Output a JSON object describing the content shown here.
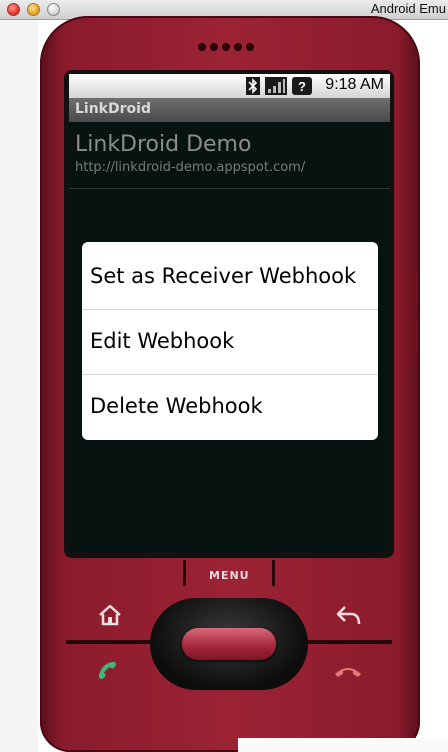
{
  "window": {
    "title": "Android Emu"
  },
  "status_bar": {
    "time": "9:18 AM",
    "icons": [
      "bluetooth-icon",
      "signal-icon",
      "alert-icon"
    ]
  },
  "app": {
    "title": "LinkDroid"
  },
  "list": {
    "item_title": "LinkDroid Demo",
    "item_url": "http://linkdroid-demo.appspot.com/"
  },
  "context_menu": {
    "items": [
      {
        "label": "Set as Receiver Webhook"
      },
      {
        "label": "Edit Webhook"
      },
      {
        "label": "Delete Webhook"
      }
    ]
  },
  "device": {
    "menu_label": "MENU",
    "buttons": [
      "home-icon",
      "back-icon",
      "call-icon",
      "end-call-icon"
    ],
    "body_color": "#9b2334"
  }
}
